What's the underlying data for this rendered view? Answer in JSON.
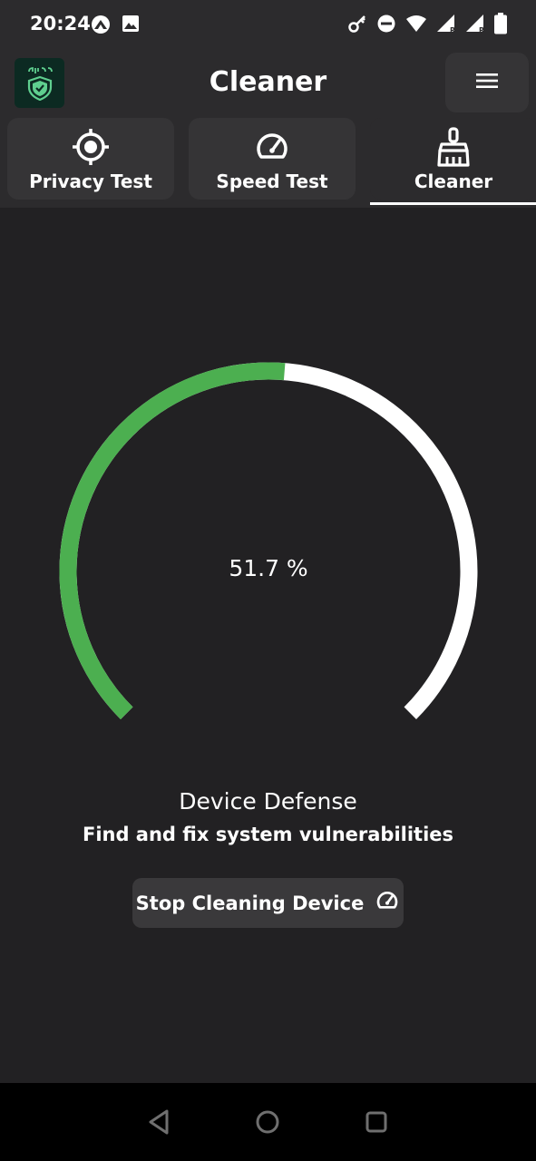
{
  "status_bar": {
    "time": "20:24",
    "icons": [
      "app-notification-icon",
      "image-icon",
      "key-icon",
      "do-not-disturb-icon",
      "wifi-icon",
      "signal-roaming-icon",
      "signal-roaming-icon",
      "battery-icon"
    ]
  },
  "header": {
    "title": "Cleaner",
    "logo_icon": "shield-logo-icon",
    "menu_icon": "hamburger-menu-icon"
  },
  "tabs": [
    {
      "label": "Privacy Test",
      "icon": "crosshair-icon",
      "selected": false
    },
    {
      "label": "Speed Test",
      "icon": "speedometer-icon",
      "selected": false
    },
    {
      "label": "Cleaner",
      "icon": "broom-icon",
      "selected": true
    }
  ],
  "gauge": {
    "value_text": "51.7 %",
    "progress_percent": 51.7,
    "progress_color": "#4caf50",
    "track_color": "#ffffff"
  },
  "content": {
    "title": "Device Defense",
    "subtitle": "Find and fix system vulnerabilities",
    "button_label": "Stop Cleaning Device",
    "button_icon": "speedometer-icon"
  },
  "nav_bar": {
    "buttons": [
      "back-icon",
      "home-icon",
      "recents-icon"
    ]
  },
  "colors": {
    "background": "#222123",
    "toolbar": "#2c2b2d",
    "card": "#353436",
    "accent": "#4caf50"
  }
}
